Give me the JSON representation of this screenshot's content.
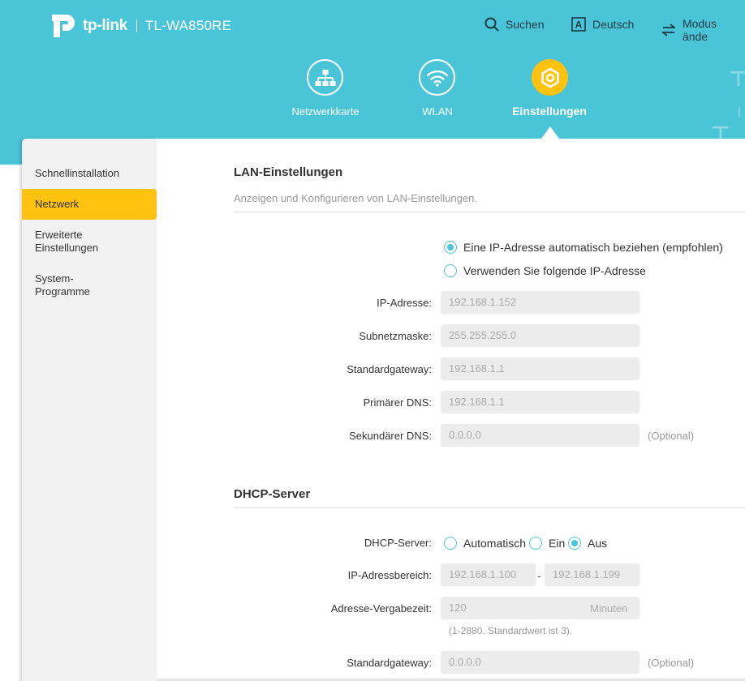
{
  "header": {
    "brand": "tp-link",
    "model": "TL-WA850RE",
    "search_label": "Suchen",
    "language_label": "Deutsch",
    "mode_label": "Modus ände",
    "language_icon_letter": "A",
    "colors": {
      "header_bg": "#4ac5d8",
      "accent": "#ffc20e",
      "radio": "#4ac5d8"
    }
  },
  "main_nav": [
    {
      "label": "Netzwerkkarte",
      "icon": "network-map-icon"
    },
    {
      "label": "WLAN",
      "icon": "wifi-icon"
    },
    {
      "label": "Einstellungen",
      "icon": "settings-gear-icon",
      "active": true
    }
  ],
  "sidebar": {
    "items": [
      {
        "label": "Schnellinstallation"
      },
      {
        "label": "Netzwerk",
        "active": true
      },
      {
        "label": "Erweiterte Einstellungen"
      },
      {
        "label": "System-Programme"
      }
    ]
  },
  "lan": {
    "title": "LAN-Einstellungen",
    "description": "Anzeigen und Konfigurieren von LAN-Einstellungen.",
    "option_auto": "Eine IP-Adresse automatisch beziehen (empfohlen)",
    "option_manual": "Verwenden Sie folgende IP-Adresse",
    "ip_label": "IP-Adresse:",
    "ip_value": "192.168.1.152",
    "subnet_label": "Subnetzmaske:",
    "subnet_value": "255.255.255.0",
    "gateway_label": "Standardgateway:",
    "gateway_value": "192.168.1.1",
    "dns1_label": "Primärer DNS:",
    "dns1_value": "192.168.1.1",
    "dns2_label": "Sekundärer DNS:",
    "dns2_value": "0.0.0.0",
    "optional_text": "(Optional)"
  },
  "dhcp": {
    "title": "DHCP-Server",
    "server_label": "DHCP-Server:",
    "option_auto": "Automatisch",
    "option_on": "Ein",
    "option_off": "Aus",
    "range_label": "IP-Adressbereich:",
    "range_start": "192.168.1.100",
    "range_separator": "-",
    "range_end": "192.168.1.199",
    "lease_label": "Adresse-Vergabezeit:",
    "lease_value": "120",
    "lease_unit": "Minuten",
    "lease_hint": "(1-2880. Standardwert ist 3).",
    "gateway_label": "Standardgateway:",
    "gateway_value": "0.0.0.0",
    "optional_text": "(Optional)"
  }
}
